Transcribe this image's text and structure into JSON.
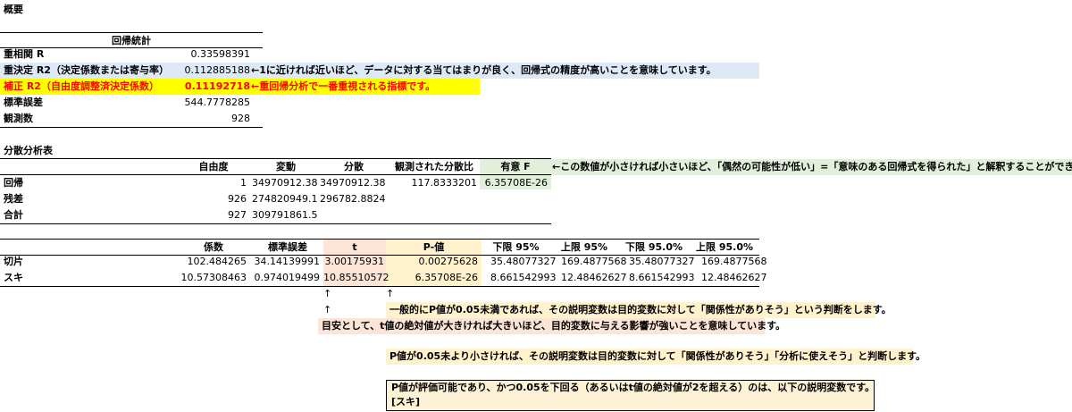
{
  "title": "概要",
  "regression": {
    "header": "回帰統計",
    "rows": [
      {
        "label": "重相関 R",
        "value": "0.33598391"
      },
      {
        "label": "重決定 R2（決定係数または寄与率）",
        "value": "0.112885188",
        "note": "←1に近ければ近いほど、データに対する当てはまりが良く、回帰式の精度が高いことを意味しています。"
      },
      {
        "label": "補正 R2（自由度調整済決定係数）",
        "value": "0.11192718",
        "note": "←重回帰分析で一番重視される指標です。"
      },
      {
        "label": "標準誤差",
        "value": "544.7778285"
      },
      {
        "label": "観測数",
        "value": "928"
      }
    ]
  },
  "anova": {
    "title": "分散分析表",
    "headers": [
      "自由度",
      "変動",
      "分散",
      "観測された分散比",
      "有意 F"
    ],
    "note": "←この数値が小さければ小さいほど、「偶然の可能性が低い」=「意味のある回帰式を得られた」と解釈することができます。",
    "rows": [
      {
        "label": "回帰",
        "cells": [
          "1",
          "34970912.38",
          "34970912.38",
          "117.8333201",
          "6.35708E-26"
        ]
      },
      {
        "label": "残差",
        "cells": [
          "926",
          "274820949.1",
          "296782.8824",
          "",
          ""
        ]
      },
      {
        "label": "合計",
        "cells": [
          "927",
          "309791861.5",
          "",
          "",
          ""
        ]
      }
    ]
  },
  "coef": {
    "headers": [
      "係数",
      "標準誤差",
      "t",
      "P-値",
      "下限 95%",
      "上限 95%",
      "下限 95.0%",
      "上限 95.0%"
    ],
    "rows": [
      {
        "label": "切片",
        "cells": [
          "102.484265",
          "34.14139991",
          "3.00175931",
          "0.00275628",
          "35.48077327",
          "169.4877568",
          "35.48077327",
          "169.4877568"
        ]
      },
      {
        "label": "スキ",
        "cells": [
          "10.57308463",
          "0.974019499",
          "10.85510572",
          "6.35708E-26",
          "8.661542993",
          "12.48462627",
          "8.661542993",
          "12.48462627"
        ]
      }
    ]
  },
  "arrows": {
    "up": "↑"
  },
  "notes": {
    "p_note": "一般的にP値が0.05未満であれば、その説明変数は目的変数に対して「関係性がありそう」という判断をします。",
    "t_note": "目安として、t値の絶対値が大きければ大きいほど、目的変数に与える影響が強いことを意味しています。",
    "p_note2": "P値が0.05未より小さければ、その説明変数は目的変数に対して「関係性がありそう」「分析に使えそう」と判断します。",
    "box_line1": "P値が評価可能であり、かつ0.05を下回る（あるいはt値の絶対値が2を超える）のは、以下の説明変数です。",
    "box_line2": "[スキ]"
  },
  "colors": {
    "blue_bg": "#dde9f6",
    "yellow_bg": "#ffff00",
    "red_text": "#ff0000",
    "green_bg": "#e2efda",
    "salmon_bg": "#fce4d6",
    "peach_bg": "#fff2cc"
  }
}
